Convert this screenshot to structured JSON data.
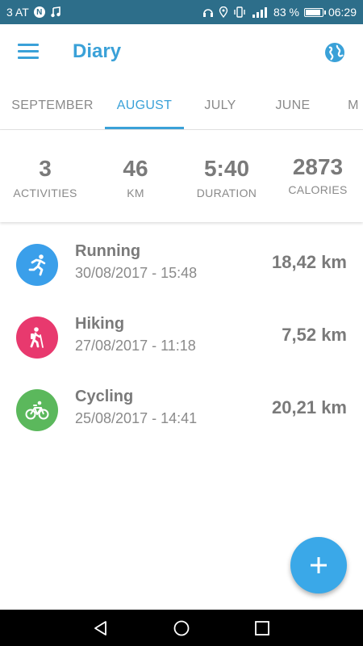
{
  "status_bar": {
    "carrier": "3 AT",
    "battery_percent": "83 %",
    "battery_level": 0.83,
    "time": "06:29",
    "icons": [
      "nfc-icon",
      "music-note-icon",
      "headphones-icon",
      "location-icon",
      "vibrate-icon",
      "signal-icon",
      "battery-icon"
    ]
  },
  "app_bar": {
    "title": "Diary",
    "icons": [
      "menu-icon",
      "globe-icon"
    ]
  },
  "tabs": [
    {
      "label": "SEPTEMBER",
      "active": false
    },
    {
      "label": "AUGUST",
      "active": true
    },
    {
      "label": "JULY",
      "active": false
    },
    {
      "label": "JUNE",
      "active": false
    },
    {
      "label": "M",
      "active": false
    }
  ],
  "summary": {
    "activities": {
      "value": "3",
      "label": "ACTIVITIES"
    },
    "km": {
      "value": "46",
      "label": "KM"
    },
    "duration": {
      "value": "5:40",
      "label": "DURATION"
    },
    "calories": {
      "value": "2873",
      "label": "CALORIES"
    }
  },
  "activities": [
    {
      "name": "Running",
      "date": "30/08/2017 - 15:48",
      "distance": "18,42 km",
      "icon": "running-icon",
      "color": "#3a9fea"
    },
    {
      "name": "Hiking",
      "date": "27/08/2017 - 11:18",
      "distance": "7,52 km",
      "icon": "hiking-icon",
      "color": "#e8396e"
    },
    {
      "name": "Cycling",
      "date": "25/08/2017 - 14:41",
      "distance": "20,21 km",
      "icon": "cycling-icon",
      "color": "#5bb85c"
    }
  ],
  "fab": {
    "icon": "plus-icon"
  },
  "nav_bar": {
    "icons": [
      "back-icon",
      "home-icon",
      "recents-icon"
    ]
  },
  "colors": {
    "accent": "#3aa1d8",
    "status_bar": "#2d6e8a",
    "fab": "#3aa8e8"
  }
}
